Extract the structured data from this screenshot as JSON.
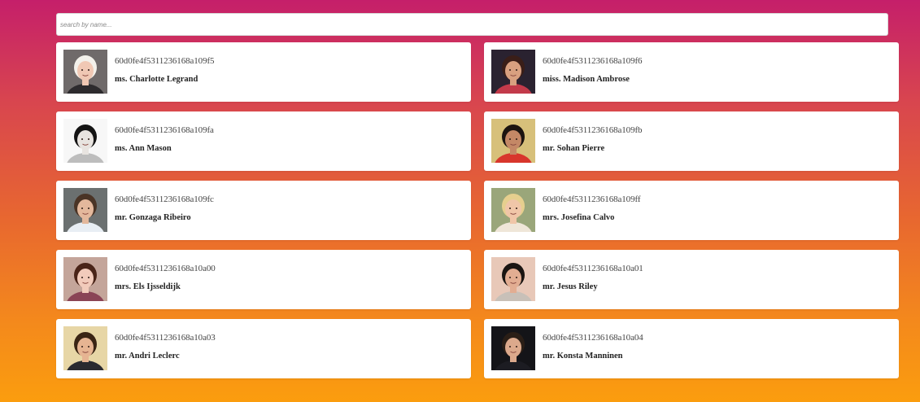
{
  "search": {
    "placeholder": "search by name...",
    "value": ""
  },
  "users": [
    {
      "id": "60d0fe4f5311236168a109f5",
      "name": "ms. Charlotte Legrand",
      "avatar_icon": "person-photo",
      "skin": "#f0c8b4",
      "hair": "#f2f0ea",
      "bg": "#6f6a6a",
      "shirt": "#2d2b2e"
    },
    {
      "id": "60d0fe4f5311236168a109f6",
      "name": "miss. Madison Ambrose",
      "avatar_icon": "person-photo",
      "skin": "#d8a080",
      "hair": "#3a1e18",
      "bg": "#2a2230",
      "shirt": "#c23a4a"
    },
    {
      "id": "60d0fe4f5311236168a109fa",
      "name": "ms. Ann Mason",
      "avatar_icon": "person-photo",
      "skin": "#e8e4e0",
      "hair": "#141414",
      "bg": "#f7f7f7",
      "shirt": "#bdbdbd"
    },
    {
      "id": "60d0fe4f5311236168a109fb",
      "name": "mr. Sohan Pierre",
      "avatar_icon": "person-photo",
      "skin": "#c48866",
      "hair": "#1c1410",
      "bg": "#d7c07a",
      "shirt": "#d8362c"
    },
    {
      "id": "60d0fe4f5311236168a109fc",
      "name": "mr. Gonzaga Ribeiro",
      "avatar_icon": "person-photo",
      "skin": "#e3b89c",
      "hair": "#4a3426",
      "bg": "#6b7070",
      "shirt": "#e8eef4"
    },
    {
      "id": "60d0fe4f5311236168a109ff",
      "name": "mrs. Josefina Calvo",
      "avatar_icon": "person-photo",
      "skin": "#f0c6a8",
      "hair": "#e6cf8e",
      "bg": "#9aa67a",
      "shirt": "#efe6d8"
    },
    {
      "id": "60d0fe4f5311236168a10a00",
      "name": "mrs. Els Ijsseldijk",
      "avatar_icon": "person-photo",
      "skin": "#f2cbbb",
      "hair": "#4a2418",
      "bg": "#c4a59a",
      "shirt": "#8a4456"
    },
    {
      "id": "60d0fe4f5311236168a10a01",
      "name": "mr. Jesus Riley",
      "avatar_icon": "person-photo",
      "skin": "#e2ad92",
      "hair": "#1a1512",
      "bg": "#e8c8b8",
      "shirt": "#c8c0b8"
    },
    {
      "id": "60d0fe4f5311236168a10a03",
      "name": "mr. Andri Leclerc",
      "avatar_icon": "person-photo",
      "skin": "#e6b492",
      "hair": "#3a2414",
      "bg": "#e7d6a6",
      "shirt": "#2a2a30"
    },
    {
      "id": "60d0fe4f5311236168a10a04",
      "name": "mr. Konsta Manninen",
      "avatar_icon": "person-photo",
      "skin": "#dca98c",
      "hair": "#2a1e16",
      "bg": "#141418",
      "shirt": "#1c1c22"
    }
  ]
}
